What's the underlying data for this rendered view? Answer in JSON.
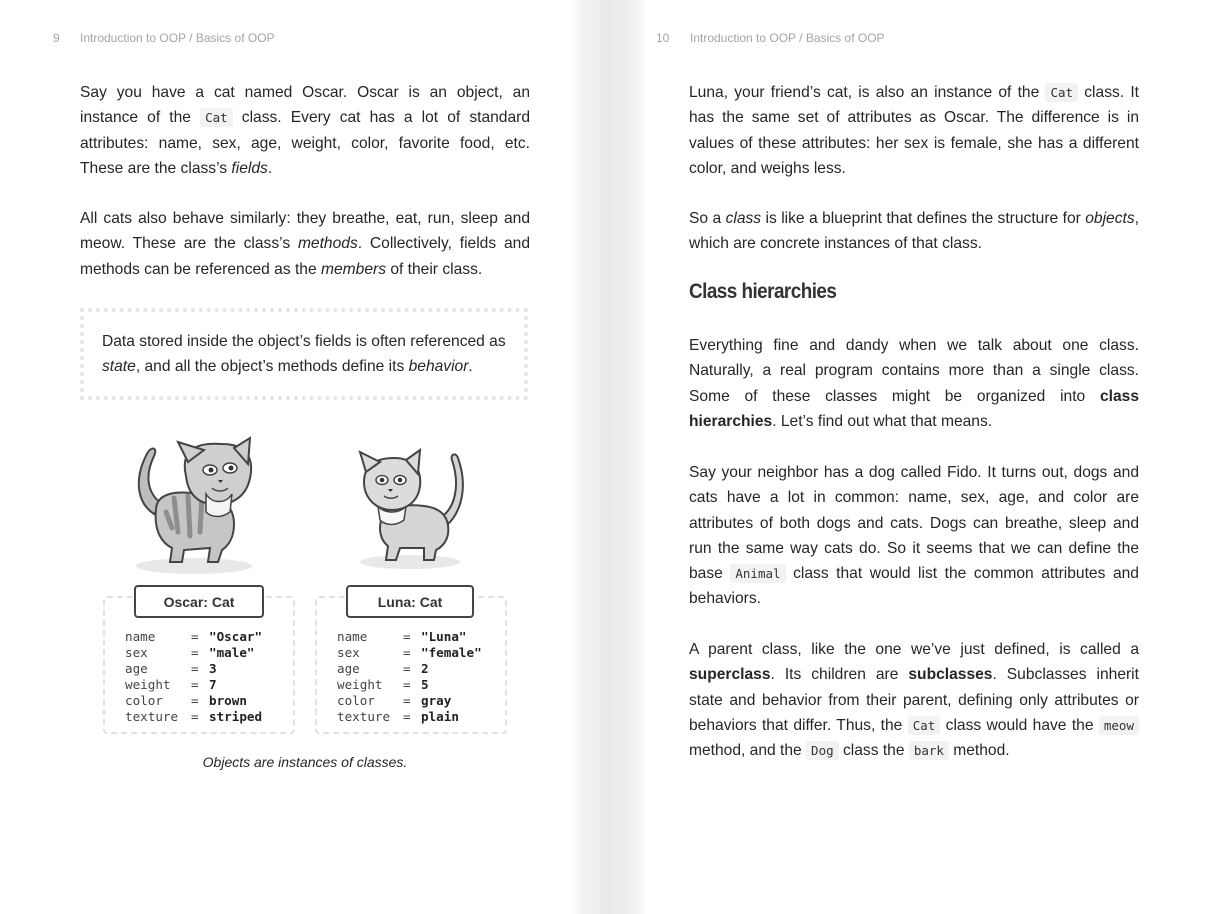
{
  "left_page": {
    "page_number": "9",
    "running_head": "Introduction to OOP / Basics of OOP",
    "p1": {
      "a": "Say you have a cat named Oscar. Oscar is an object, an instance of the ",
      "code": "Cat",
      "b": " class. Every cat has a lot of standard attributes: name, sex, age, weight, color, favorite food, etc. These are the class’s ",
      "em": "fields",
      "c": "."
    },
    "p2": {
      "a": "All cats also behave similarly: they breathe, eat, run, sleep and meow. These are the class’s ",
      "em1": "methods",
      "b": ". Collectively, fields and methods can be referenced as the ",
      "em2": "members",
      "c": " of their class."
    },
    "callout": {
      "a": "Data stored inside the object’s fields is often referenced as ",
      "em1": "state",
      "b": ", and all the object’s methods define its ",
      "em2": "behavior",
      "c": "."
    },
    "objects": [
      {
        "title": "Oscar: Cat",
        "attributes": [
          {
            "key": "name",
            "eq": "=",
            "value": "\"Oscar\""
          },
          {
            "key": "sex",
            "eq": "=",
            "value": "\"male\""
          },
          {
            "key": "age",
            "eq": "=",
            "value": "3"
          },
          {
            "key": "weight",
            "eq": "=",
            "value": "7"
          },
          {
            "key": "color",
            "eq": "=",
            "value": "brown"
          },
          {
            "key": "texture",
            "eq": "=",
            "value": "striped"
          }
        ]
      },
      {
        "title": "Luna: Cat",
        "attributes": [
          {
            "key": "name",
            "eq": "=",
            "value": "\"Luna\""
          },
          {
            "key": "sex",
            "eq": "=",
            "value": "\"female\""
          },
          {
            "key": "age",
            "eq": "=",
            "value": "2"
          },
          {
            "key": "weight",
            "eq": "=",
            "value": "5"
          },
          {
            "key": "color",
            "eq": "=",
            "value": "gray"
          },
          {
            "key": "texture",
            "eq": "=",
            "value": "plain"
          }
        ]
      }
    ],
    "caption": "Objects are instances of classes."
  },
  "right_page": {
    "page_number": "10",
    "running_head": "Introduction to OOP / Basics of OOP",
    "p1": {
      "a": "Luna, your friend’s cat, is also an instance of the ",
      "code": "Cat",
      "b": " class. It has the same set of attributes as Oscar. The difference is in values of these attributes: her sex is female, she has a different color, and weighs less."
    },
    "p2": {
      "a": "So a ",
      "em1": "class",
      "b": " is like a blueprint that defines the structure for ",
      "em2": "objects",
      "c": ", which are concrete instances of that class."
    },
    "heading": "Class hierarchies",
    "p3": {
      "a": "Everything fine and dandy when we talk about one class. Naturally, a real program contains more than a single class. Some of these classes might be organized into ",
      "strong": "class hierarchies",
      "b": ". Let’s find out what that means."
    },
    "p4": {
      "a": "Say your neighbor has a dog called Fido. It turns out, dogs and cats have a lot in common: name, sex, age, and color are attributes of both dogs and cats. Dogs can breathe, sleep and run the same way cats do. So it seems that we can define the base ",
      "code": "Animal",
      "b": " class that would list the common attributes and behaviors."
    },
    "p5": {
      "a": "A parent class, like the one we’ve just defined, is called a ",
      "strong1": "superclass",
      "b": ". Its children are ",
      "strong2": "subclasses",
      "c": ". Subclasses inherit state and behavior from their parent, defining only attributes or behaviors that differ. Thus, the ",
      "code1": "Cat",
      "d": " class would have the ",
      "code2": "meow",
      "e": " method, and the ",
      "code3": "Dog",
      "f": " class the ",
      "code4": "bark",
      "g": " method."
    }
  }
}
